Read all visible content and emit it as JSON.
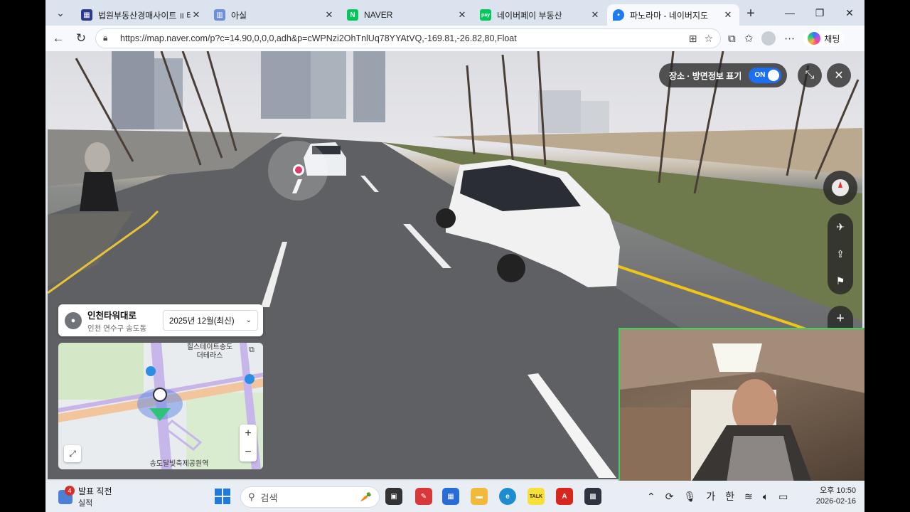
{
  "browser": {
    "tabs": [
      {
        "label": "법원부동산경매사이트 ॥ 테",
        "favicon_color": "#2b3a8f",
        "active": false
      },
      {
        "label": "아실",
        "favicon_color": "#6e8fd8",
        "active": false
      },
      {
        "label": "NAVER",
        "favicon_color": "#03c75a",
        "favicon_text": "N",
        "active": false
      },
      {
        "label": "네이버페이 부동산",
        "favicon_color": "#03c75a",
        "favicon_text": "pay",
        "active": false
      },
      {
        "label": "파노라마 - 네이버지도",
        "favicon_color": "#1d7bf3",
        "active": true
      }
    ],
    "url": "https://map.naver.com/p?c=14.90,0,0,0,adh&p=cWPNzi2OhTnlUq78YYAtVQ,-169.81,-26.82,80,Float",
    "copilot_label": "채팅"
  },
  "panorama": {
    "toggle_label": "장소 · 방면정보 표기",
    "toggle_state": "ON",
    "location_name": "인천타워대로",
    "location_address": "인천 연수구 송도동",
    "date_selected": "2025년 12월(최신)"
  },
  "minimap": {
    "label_top": "힐스테이트송도",
    "label_top2": "더테라스",
    "label_bottom": "송도달빛축제공원역"
  },
  "taskbar": {
    "weather_title": "발표 직전",
    "weather_sub": "실적",
    "notification_count": "4",
    "search_placeholder": "검색",
    "ime_lang": "가",
    "ime_mode": "한",
    "time": "오후 10:50",
    "date": "2026-02-16"
  }
}
